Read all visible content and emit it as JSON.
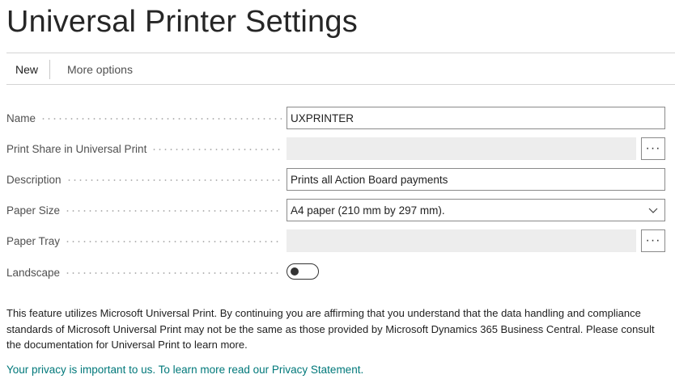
{
  "page": {
    "title": "Universal Printer Settings"
  },
  "actions": {
    "new_label": "New",
    "more_options_label": "More options"
  },
  "fields": {
    "name": {
      "label": "Name",
      "value": "UXPRINTER"
    },
    "print_share": {
      "label": "Print Share in Universal Print",
      "value": "",
      "lookup_glyph": "···"
    },
    "description": {
      "label": "Description",
      "value": "Prints all Action Board payments"
    },
    "paper_size": {
      "label": "Paper Size",
      "value": "A4 paper (210 mm by 297 mm)."
    },
    "paper_tray": {
      "label": "Paper Tray",
      "value": "",
      "lookup_glyph": "···"
    },
    "landscape": {
      "label": "Landscape",
      "checked": false
    }
  },
  "notice": {
    "text": "This feature utilizes Microsoft Universal Print. By continuing you are affirming that you understand that the data handling and compliance standards of Microsoft Universal Print may not be the same as those provided by Microsoft Dynamics 365 Business Central. Please consult the documentation for Universal Print to learn more."
  },
  "privacy": {
    "link_text": "Your privacy is important to us. To learn more read our Privacy Statement."
  },
  "colors": {
    "link": "#00787a",
    "disabled_field": "#ededed",
    "border": "#8a8a8a"
  }
}
